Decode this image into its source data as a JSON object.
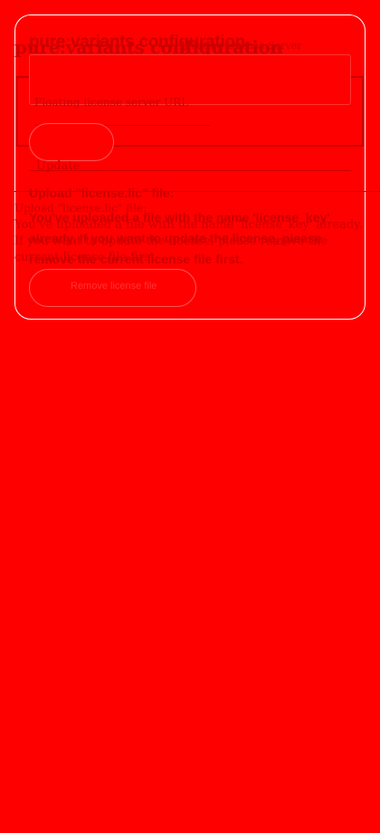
{
  "page": {
    "title": "pure:variants configuration",
    "subtitle": "Floating License Server"
  },
  "license_server": {
    "field_label": "Floating license server URL",
    "field_value": "",
    "update_button": "Update"
  },
  "upload": {
    "heading": "Upload \"license.lic\" file:",
    "message": "You've uploaded a file with the name 'license_key' already. If you want to update the license, please remove the current license file first.",
    "remove_button": "Remove license file"
  },
  "colors": {
    "background": "#ff0000",
    "text": "#cc0000",
    "panel_border": "#ffffff"
  }
}
